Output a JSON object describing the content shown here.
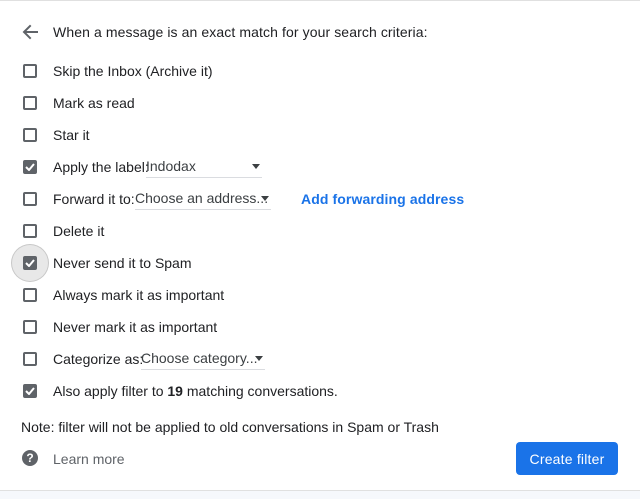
{
  "header": {
    "title": "When a message is an exact match for your search criteria:"
  },
  "options": {
    "skip_inbox": {
      "label": "Skip the Inbox (Archive it)",
      "checked": false
    },
    "mark_read": {
      "label": "Mark as read",
      "checked": false
    },
    "star": {
      "label": "Star it",
      "checked": false
    },
    "apply_label": {
      "label": "Apply the label:",
      "checked": true,
      "select_value": "Indodax"
    },
    "forward": {
      "label": "Forward it to:",
      "checked": false,
      "select_value": "Choose an address...",
      "link": "Add forwarding address"
    },
    "delete": {
      "label": "Delete it",
      "checked": false
    },
    "never_spam": {
      "label": "Never send it to Spam",
      "checked": true
    },
    "always_important": {
      "label": "Always mark it as important",
      "checked": false
    },
    "never_important": {
      "label": "Never mark it as important",
      "checked": false
    },
    "categorize": {
      "label": "Categorize as:",
      "checked": false,
      "select_value": "Choose category..."
    },
    "also_apply": {
      "label_prefix": "Also apply filter to ",
      "count": "19",
      "label_suffix": " matching conversations.",
      "checked": true
    }
  },
  "note": "Note: filter will not be applied to old conversations in Spam or Trash",
  "footer": {
    "learn_more": "Learn more",
    "create_button": "Create filter"
  },
  "colors": {
    "accent": "#1a73e8",
    "checkbox": "#5f6368"
  },
  "icons": {
    "back": "arrow-back-icon",
    "help": "help-icon"
  }
}
